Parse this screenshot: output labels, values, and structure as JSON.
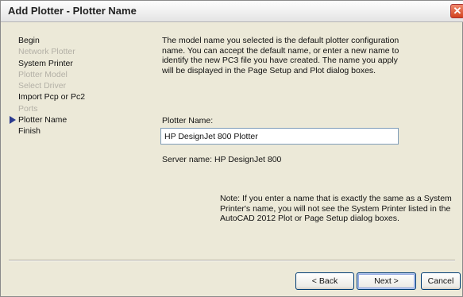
{
  "window": {
    "title": "Add Plotter - Plotter Name",
    "close_symbol": "✕",
    "close_icon": "close-icon"
  },
  "steps": [
    {
      "label": "Begin",
      "enabled": true,
      "current": false
    },
    {
      "label": "Network Plotter",
      "enabled": false,
      "current": false
    },
    {
      "label": "System Printer",
      "enabled": true,
      "current": false
    },
    {
      "label": "Plotter Model",
      "enabled": false,
      "current": false
    },
    {
      "label": "Select Driver",
      "enabled": false,
      "current": false
    },
    {
      "label": "Import Pcp or Pc2",
      "enabled": true,
      "current": false
    },
    {
      "label": "Ports",
      "enabled": false,
      "current": false
    },
    {
      "label": "Plotter Name",
      "enabled": true,
      "current": true
    },
    {
      "label": "Finish",
      "enabled": true,
      "current": false
    }
  ],
  "current_step_icon": "arrow-right-icon",
  "content": {
    "description": "The model name you selected is the default plotter configuration name. You can accept the default name, or enter a new name to identify the new PC3 file you have created. The name you apply will be displayed in the Page Setup and Plot dialog boxes.",
    "plotter_name_label": "Plotter Name:",
    "plotter_name_value": "HP DesignJet 800 Plotter",
    "server_name": "Server name: HP DesignJet 800",
    "note": "Note: If you enter a name that is exactly the same as a System Printer's name, you will not see the System Printer listed in the AutoCAD 2012 Plot or Page Setup dialog boxes."
  },
  "buttons": {
    "back": "< Back",
    "next": "Next >",
    "cancel": "Cancel"
  }
}
